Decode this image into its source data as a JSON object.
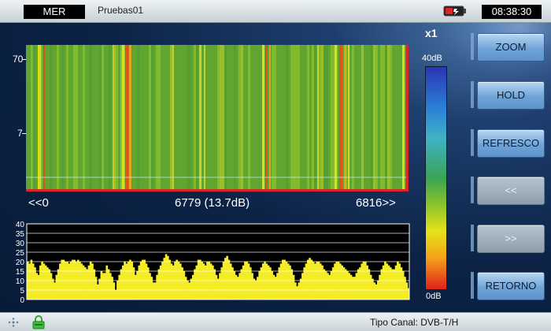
{
  "header": {
    "mode": "MER",
    "profile": "Pruebas01",
    "time": "08:38:30"
  },
  "waterfall": {
    "y_ticks": [
      "70",
      "7"
    ],
    "nav_left": "<<0",
    "marker": "6779 (13.7dB)",
    "nav_right": "6816>>"
  },
  "scale": {
    "multiplier": "x1",
    "top_label": "40dB",
    "bottom_label": "0dB"
  },
  "chart_data": {
    "type": "bar",
    "title": "",
    "xlabel": "",
    "ylabel": "",
    "ylim": [
      0,
      40
    ],
    "y_ticks": [
      "0",
      "5",
      "10",
      "15",
      "20",
      "25",
      "30",
      "35",
      "40"
    ],
    "grid": true,
    "values": [
      20,
      19,
      21,
      19,
      17,
      14,
      13,
      18,
      20,
      19,
      18,
      17,
      16,
      14,
      11,
      9,
      13,
      16,
      19,
      21,
      21,
      20,
      20,
      19,
      20,
      21,
      21,
      20,
      21,
      20,
      19,
      18,
      17,
      16,
      18,
      20,
      19,
      16,
      12,
      8,
      11,
      15,
      14,
      14,
      18,
      16,
      14,
      12,
      9,
      5,
      10,
      13,
      16,
      18,
      20,
      19,
      20,
      21,
      20,
      17,
      13,
      15,
      18,
      20,
      21,
      21,
      19,
      17,
      14,
      12,
      9,
      9,
      13,
      16,
      18,
      20,
      22,
      24,
      23,
      21,
      19,
      18,
      20,
      21,
      20,
      19,
      17,
      15,
      12,
      10,
      9,
      11,
      13,
      16,
      18,
      21,
      21,
      20,
      19,
      18,
      20,
      20,
      19,
      18,
      16,
      13,
      11,
      14,
      17,
      20,
      22,
      23,
      21,
      19,
      17,
      15,
      13,
      12,
      14,
      16,
      18,
      20,
      20,
      19,
      17,
      14,
      11,
      10,
      12,
      15,
      17,
      19,
      20,
      19,
      18,
      17,
      15,
      13,
      12,
      14,
      17,
      19,
      21,
      21,
      20,
      19,
      18,
      16,
      13,
      9,
      7,
      9,
      11,
      14,
      17,
      19,
      21,
      22,
      21,
      20,
      19,
      20,
      20,
      19,
      18,
      16,
      15,
      14,
      13,
      15,
      17,
      19,
      20,
      20,
      19,
      18,
      17,
      16,
      15,
      14,
      13,
      12,
      12,
      14,
      16,
      17,
      19,
      20,
      20,
      18,
      16,
      13,
      11,
      9,
      8,
      10,
      13,
      16,
      18,
      20,
      19,
      18,
      17,
      16,
      16,
      18,
      20,
      19,
      17,
      15,
      12,
      9,
      6
    ]
  },
  "buttons": [
    {
      "label": "ZOOM",
      "enabled": true
    },
    {
      "label": "HOLD",
      "enabled": true
    },
    {
      "label": "REFRESCO",
      "enabled": true
    },
    {
      "label": "<<",
      "enabled": false
    },
    {
      "label": ">>",
      "enabled": false
    },
    {
      "label": "RETORNO",
      "enabled": true
    }
  ],
  "status": {
    "channel_type": "Tipo Canal: DVB-T/H"
  },
  "colors": {
    "bar_fill": "#f4ec24",
    "hist_bg": "#000000",
    "button": "#6fa4d7"
  },
  "icons": [
    "network-icon",
    "lock-icon",
    "battery-icon"
  ]
}
